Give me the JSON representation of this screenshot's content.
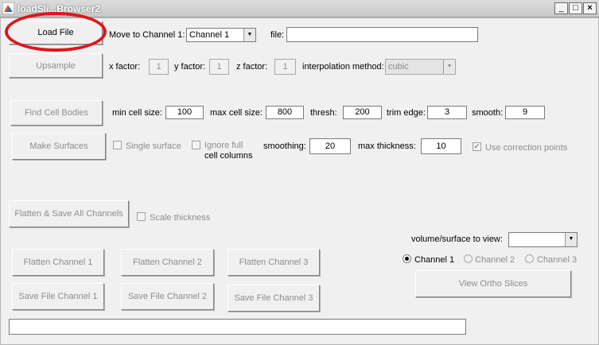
{
  "window": {
    "title": "loadSli...Browser2",
    "minimize": "_",
    "maximize": "□",
    "close": "×"
  },
  "row1": {
    "load_file_label": "Load File",
    "move_to_channel_label": "Move to Channel 1:",
    "channel_select_value": "Channel 1",
    "file_label": "file:",
    "file_value": ""
  },
  "row2": {
    "upsample_label": "Upsample",
    "x_factor_label": "x factor:",
    "x_factor_value": "1",
    "y_factor_label": "y factor:",
    "y_factor_value": "1",
    "z_factor_label": "z factor:",
    "z_factor_value": "1",
    "interp_label": "interpolation method:",
    "interp_value": "cubic"
  },
  "row3": {
    "find_cells_label": "Find Cell Bodies",
    "min_cell_label": "min cell size:",
    "min_cell_value": "100",
    "max_cell_label": "max cell size:",
    "max_cell_value": "800",
    "thresh_label": "thresh:",
    "thresh_value": "200",
    "trim_label": "trim edge:",
    "trim_value": "3",
    "smooth_label": "smooth:",
    "smooth_value": "9"
  },
  "row4": {
    "make_surfaces_label": "Make Surfaces",
    "single_surface_label": "Single surface",
    "ignore_full_line1": "Ignore full",
    "ignore_full_line2": "cell columns",
    "smoothing_label": "smoothing:",
    "smoothing_value": "20",
    "max_thickness_label": "max thickness:",
    "max_thickness_value": "10",
    "use_correction_label": "Use correction points",
    "use_correction_checked": true
  },
  "row5": {
    "flatten_all_label": "Flatten & Save All Channels",
    "scale_thickness_label": "Scale thickness"
  },
  "view": {
    "volume_label": "volume/surface to view:",
    "volume_value": "",
    "radio_options": [
      "Channel 1",
      "Channel 2",
      "Channel 3"
    ],
    "selected_radio": "Channel 1",
    "ortho_label": "View Ortho Slices"
  },
  "channels": {
    "flatten": [
      "Flatten Channel 1",
      "Flatten Channel 2",
      "Flatten  Channel 3"
    ],
    "save": [
      "Save File Channel 1",
      "Save File Channel 2",
      "Save File Channel 3"
    ]
  },
  "status": {
    "value": ""
  },
  "colors": {
    "annotation_ring": "#e0141c",
    "panel_bg": "#f0f0f0",
    "disabled_text": "#8d8d8d"
  }
}
